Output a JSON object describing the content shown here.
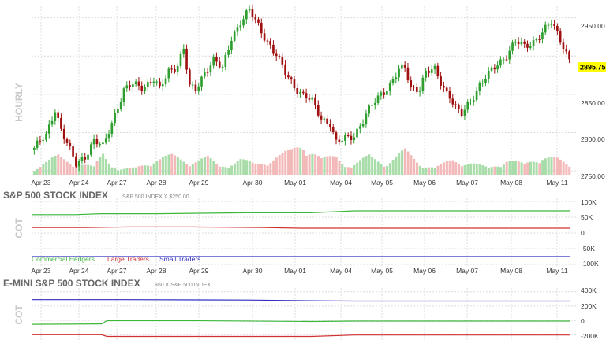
{
  "chart": {
    "timeframe_label": "HOURLY",
    "price_ticks": [
      "2950.00",
      "2900.00",
      "2850.00",
      "2800.00",
      "2750.00"
    ],
    "last_price": "2895.75",
    "last_price_color": "#ffff00",
    "up_color": "#2e9e2e",
    "down_color": "#a01010",
    "x_labels": [
      "Apr 23",
      "Apr 24",
      "Apr 27",
      "Apr 28",
      "Apr 29",
      "Apr 30",
      "May 01",
      "May 04",
      "May 05",
      "May 06",
      "May 07",
      "May 08",
      "May 11"
    ]
  },
  "cot_panel_1": {
    "title": "S&P 500 STOCK INDEX",
    "subtitle": "S&P 500 INDEX X $250.00",
    "side_label": "COT",
    "y_ticks": [
      "100K",
      "50K",
      "0",
      "-50K",
      "-100K"
    ],
    "legend": [
      {
        "label": "Commercial Hedgers",
        "color": "#3cb83c"
      },
      {
        "label": "Large Traders",
        "color": "#d03030"
      },
      {
        "label": "Small Traders",
        "color": "#3030c0"
      }
    ]
  },
  "cot_panel_2": {
    "title": "E-MINI S&P 500 STOCK INDEX",
    "subtitle": "$50 X S&P 500 INDEX",
    "side_label": "COT",
    "y_ticks": [
      "400K",
      "200K",
      "0",
      "-200K"
    ]
  },
  "chart_data": [
    {
      "type": "candlestick",
      "title": "",
      "ylabel": "",
      "ylim": [
        2745,
        2965
      ],
      "x_labels": [
        "Apr 23",
        "Apr 24",
        "Apr 27",
        "Apr 28",
        "Apr 29",
        "Apr 30",
        "May 01",
        "May 04",
        "May 05",
        "May 06",
        "May 07",
        "May 08",
        "May 11"
      ],
      "anchors": [
        [
          0,
          2780
        ],
        [
          4,
          2795
        ],
        [
          7,
          2832
        ],
        [
          9,
          2805
        ],
        [
          12,
          2775
        ],
        [
          14,
          2758
        ],
        [
          17,
          2770
        ],
        [
          20,
          2790
        ],
        [
          23,
          2780
        ],
        [
          27,
          2825
        ],
        [
          30,
          2855
        ],
        [
          33,
          2862
        ],
        [
          36,
          2860
        ],
        [
          40,
          2870
        ],
        [
          42,
          2855
        ],
        [
          45,
          2880
        ],
        [
          48,
          2890
        ],
        [
          50,
          2910
        ],
        [
          52,
          2858
        ],
        [
          54,
          2855
        ],
        [
          57,
          2880
        ],
        [
          60,
          2895
        ],
        [
          63,
          2882
        ],
        [
          66,
          2925
        ],
        [
          69,
          2945
        ],
        [
          72,
          2958
        ],
        [
          75,
          2940
        ],
        [
          78,
          2920
        ],
        [
          81,
          2900
        ],
        [
          84,
          2878
        ],
        [
          87,
          2862
        ],
        [
          90,
          2848
        ],
        [
          93,
          2840
        ],
        [
          96,
          2820
        ],
        [
          99,
          2812
        ],
        [
          101,
          2785
        ],
        [
          104,
          2792
        ],
        [
          107,
          2798
        ],
        [
          110,
          2815
        ],
        [
          113,
          2835
        ],
        [
          116,
          2852
        ],
        [
          119,
          2862
        ],
        [
          122,
          2880
        ],
        [
          124,
          2885
        ],
        [
          126,
          2860
        ],
        [
          129,
          2858
        ],
        [
          131,
          2877
        ],
        [
          134,
          2882
        ],
        [
          137,
          2860
        ],
        [
          139,
          2848
        ],
        [
          141,
          2830
        ],
        [
          143,
          2823
        ],
        [
          146,
          2843
        ],
        [
          149,
          2862
        ],
        [
          152,
          2875
        ],
        [
          155,
          2890
        ],
        [
          158,
          2902
        ],
        [
          161,
          2918
        ],
        [
          164,
          2912
        ],
        [
          167,
          2920
        ],
        [
          170,
          2930
        ],
        [
          173,
          2943
        ],
        [
          175,
          2930
        ],
        [
          177,
          2915
        ],
        [
          179,
          2895
        ]
      ],
      "volume_profile": [
        [
          0,
          0.18
        ],
        [
          8,
          0.55
        ],
        [
          14,
          0.35
        ],
        [
          20,
          0.22
        ],
        [
          23,
          0.65
        ],
        [
          28,
          0.15
        ],
        [
          34,
          0.2
        ],
        [
          40,
          0.45
        ],
        [
          46,
          0.55
        ],
        [
          52,
          0.4
        ],
        [
          58,
          0.5
        ],
        [
          62,
          0.25
        ],
        [
          69,
          0.45
        ],
        [
          74,
          0.3
        ],
        [
          80,
          0.5
        ],
        [
          86,
          0.7
        ],
        [
          90,
          1.0
        ],
        [
          96,
          0.45
        ],
        [
          101,
          0.55
        ],
        [
          106,
          0.25
        ],
        [
          112,
          0.55
        ],
        [
          118,
          0.35
        ],
        [
          124,
          0.7
        ],
        [
          129,
          0.35
        ],
        [
          134,
          0.2
        ],
        [
          140,
          0.45
        ],
        [
          146,
          0.35
        ],
        [
          152,
          0.2
        ],
        [
          158,
          0.45
        ],
        [
          164,
          0.3
        ],
        [
          170,
          0.6
        ],
        [
          175,
          0.45
        ],
        [
          179,
          0.25
        ]
      ]
    },
    {
      "type": "line",
      "title": "S&P 500 STOCK INDEX",
      "ylim": [
        -100000,
        100000
      ],
      "series": [
        {
          "name": "Commercial Hedgers",
          "color": "#3cb83c",
          "points": [
            [
              0,
              58000
            ],
            [
              8,
              58000
            ],
            [
              13,
              61000
            ],
            [
              13,
              61000
            ],
            [
              23,
              61000
            ],
            [
              40,
              64000
            ],
            [
              52,
              64000
            ],
            [
              60,
              70000
            ],
            [
              100,
              70000
            ]
          ]
        },
        {
          "name": "Large Traders",
          "color": "#d03030",
          "points": [
            [
              0,
              17000
            ],
            [
              10,
              17000
            ],
            [
              18,
              19000
            ],
            [
              30,
              19000
            ],
            [
              43,
              17000
            ],
            [
              50,
              15000
            ],
            [
              100,
              15000
            ]
          ]
        },
        {
          "name": "Small Traders",
          "color": "#3030c0",
          "points": [
            [
              0,
              -75000
            ],
            [
              100,
              -75000
            ]
          ]
        }
      ]
    },
    {
      "type": "line",
      "title": "E-MINI S&P 500 STOCK INDEX",
      "ylim": [
        -230000,
        430000
      ],
      "series": [
        {
          "name": "Small Traders",
          "color": "#3030c0",
          "points": [
            [
              0,
              290000
            ],
            [
              18,
              290000
            ],
            [
              40,
              285000
            ],
            [
              52,
              275000
            ],
            [
              60,
              270000
            ],
            [
              100,
              270000
            ]
          ]
        },
        {
          "name": "Commercial Hedgers",
          "color": "#3cb83c",
          "points": [
            [
              0,
              -55000
            ],
            [
              13,
              -50000
            ],
            [
              14,
              -5000
            ],
            [
              30,
              -5000
            ],
            [
              52,
              -15000
            ],
            [
              60,
              -10000
            ],
            [
              100,
              -10000
            ]
          ]
        },
        {
          "name": "Large Traders",
          "color": "#d03030",
          "points": [
            [
              0,
              -200000
            ],
            [
              13,
              -200000
            ],
            [
              14,
              -225000
            ],
            [
              52,
              -225000
            ],
            [
              60,
              -205000
            ],
            [
              100,
              -205000
            ]
          ]
        }
      ]
    }
  ]
}
